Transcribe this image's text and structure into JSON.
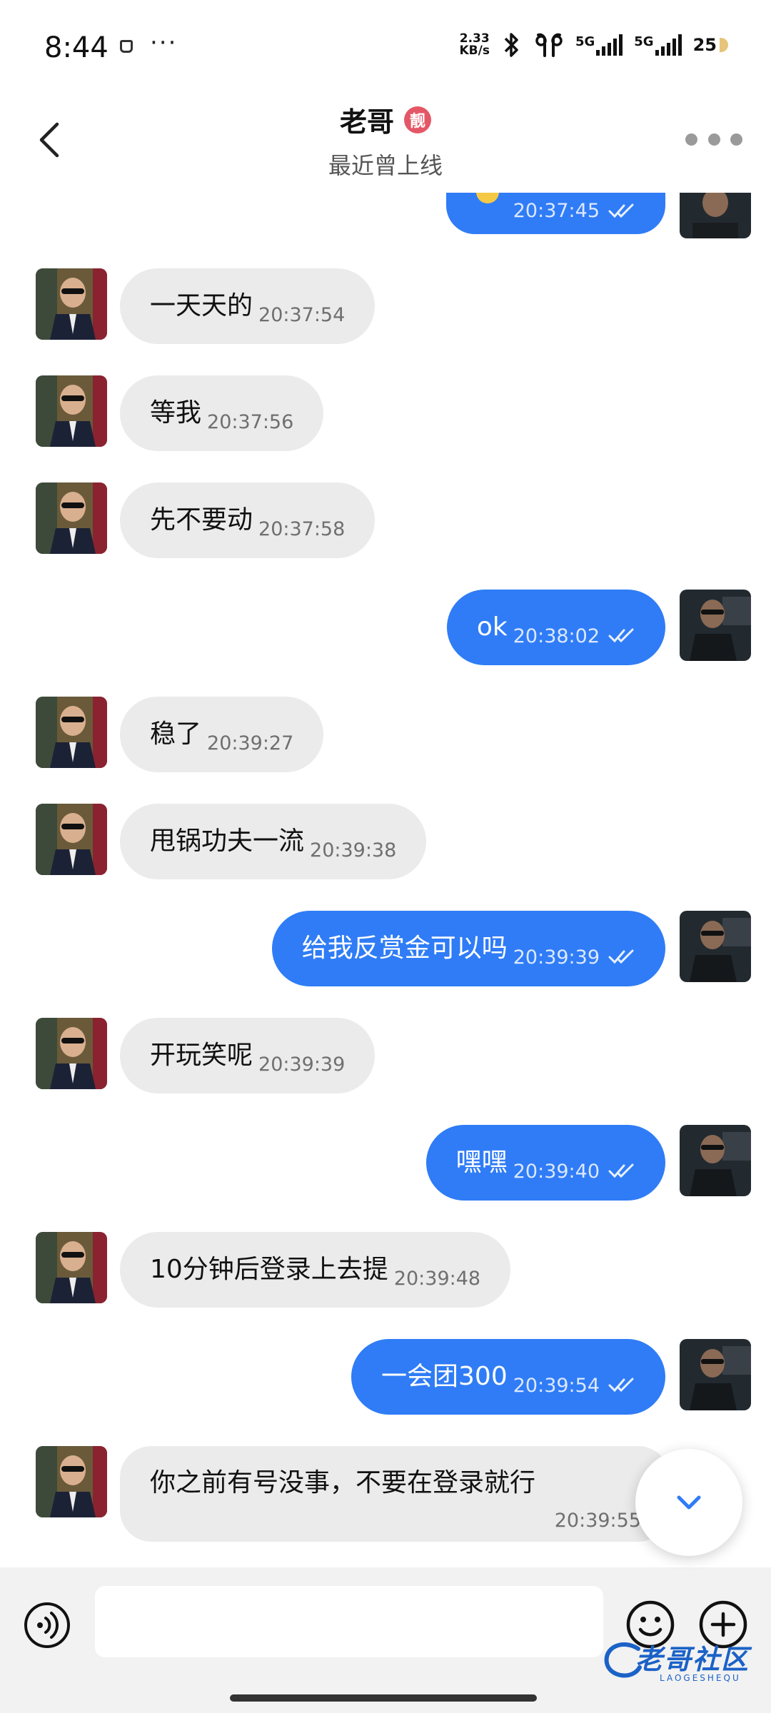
{
  "status_bar": {
    "time": "8:44",
    "dots": "···",
    "net_speed_top": "2.33",
    "net_speed_bottom": "KB/s",
    "sig1_label": "5G",
    "sig2_label": "5G",
    "battery": "25"
  },
  "header": {
    "contact_name": "老哥",
    "badge": "靓",
    "status": "最近曾上线"
  },
  "messages": [
    {
      "dir": "out",
      "text": "",
      "time": "20:37:45",
      "emoji": "sleepy-face-emoji"
    },
    {
      "dir": "in",
      "text": "一天天的",
      "time": "20:37:54"
    },
    {
      "dir": "in",
      "text": "等我",
      "time": "20:37:56"
    },
    {
      "dir": "in",
      "text": "先不要动",
      "time": "20:37:58"
    },
    {
      "dir": "out",
      "text": "ok",
      "time": "20:38:02"
    },
    {
      "dir": "in",
      "text": "稳了",
      "time": "20:39:27"
    },
    {
      "dir": "in",
      "text": "甩锅功夫一流",
      "time": "20:39:38"
    },
    {
      "dir": "out",
      "text": "给我反赏金可以吗",
      "time": "20:39:39"
    },
    {
      "dir": "in",
      "text": "开玩笑呢",
      "time": "20:39:39"
    },
    {
      "dir": "out",
      "text": "嘿嘿",
      "time": "20:39:40"
    },
    {
      "dir": "in",
      "text": "10分钟后登录上去提",
      "time": "20:39:48"
    },
    {
      "dir": "out",
      "text": "一会团300",
      "time": "20:39:54"
    },
    {
      "dir": "in",
      "text": "你之前有号没事，不要在登录就行",
      "time": "20:39:55"
    }
  ],
  "input": {
    "placeholder": "",
    "value": ""
  },
  "watermark": {
    "text": "老哥社区",
    "sub": "LAOGESHEQU"
  },
  "colors": {
    "outgoing_bubble": "#2f7cf6",
    "incoming_bubble": "#ebebeb",
    "badge": "#e45766"
  }
}
